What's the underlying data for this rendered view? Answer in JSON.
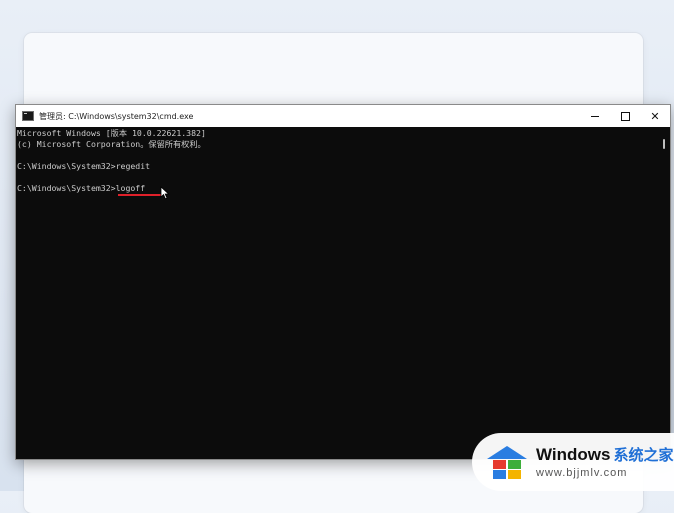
{
  "window": {
    "title": "管理员: C:\\Windows\\system32\\cmd.exe",
    "controls": {
      "minimize": "minimize",
      "maximize": "maximize",
      "close": "✕"
    }
  },
  "console": {
    "lines": [
      "Microsoft Windows [版本 10.0.22621.382]",
      "(c) Microsoft Corporation。保留所有权利。",
      "",
      "C:\\Windows\\System32>regedit",
      "",
      "C:\\Windows\\System32>logoff"
    ]
  },
  "annotation": {
    "underline_color": "#e0202a"
  },
  "watermark": {
    "brand": "Windows",
    "brand_zh": "系统之家",
    "url": "www.bjjmlv.com"
  },
  "colors": {
    "console_bg": "#0c0c0c",
    "console_text": "#cccccc",
    "logo_red": "#e63a2e",
    "logo_green": "#3cae3a",
    "logo_blue": "#2a7de1",
    "logo_yellow": "#f4b400"
  }
}
